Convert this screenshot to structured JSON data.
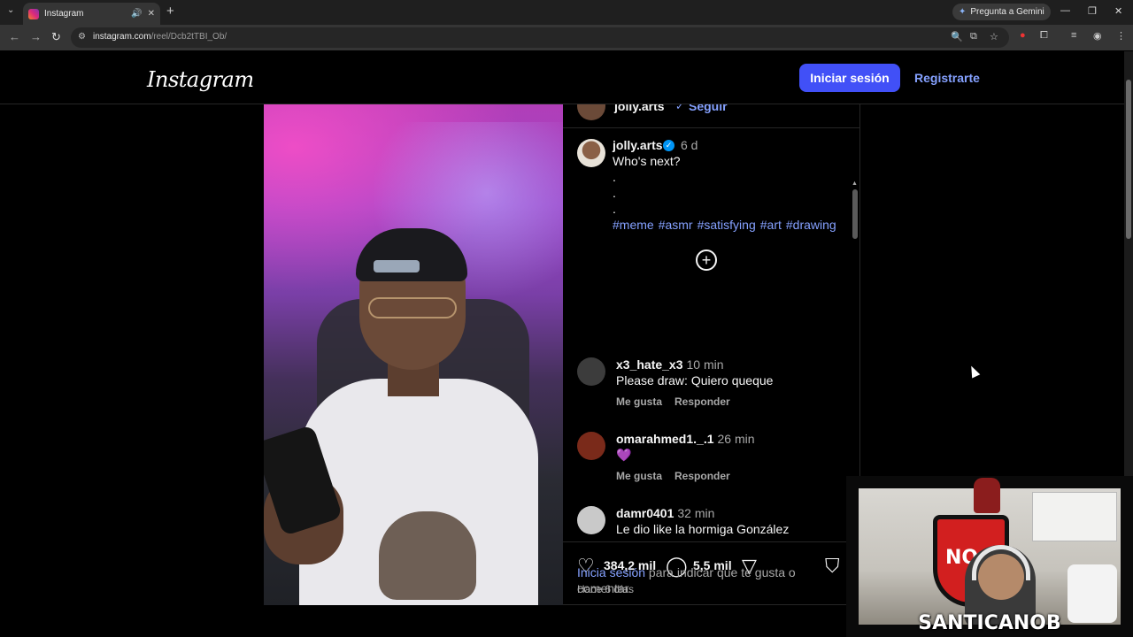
{
  "browser": {
    "tab_title": "Instagram",
    "url_host": "instagram.com",
    "url_path": "/reel/Dcb2tTBI_Ob/",
    "gemini_label": "Pregunta a Gemini"
  },
  "header": {
    "logo": "Instagram",
    "login_label": "Iniciar sesión",
    "signup_label": "Registrarte"
  },
  "post": {
    "author": "jolly.arts",
    "follow_label": "Seguir",
    "caption_time": "6 d",
    "caption_text": "Who's next?",
    "caption_dots": [
      ".",
      ".",
      "."
    ],
    "hashtags": [
      "#meme",
      "#asmr",
      "#satisfying",
      "#art",
      "#drawing"
    ]
  },
  "comments": [
    {
      "user": "x3_hate_x3",
      "time": "10 min",
      "text": "Please draw: Quiero queque",
      "like": "Me gusta",
      "reply": "Responder",
      "avatar_color": "#3c3c3c"
    },
    {
      "user": "omarahmed1._.1",
      "time": "26 min",
      "text": "💜",
      "like": "Me gusta",
      "reply": "Responder",
      "avatar_color": "#7a2a1a"
    },
    {
      "user": "damr0401",
      "time": "32 min",
      "text": "Le dio like la hormiga González",
      "like": "Me gusta",
      "reply": "Responder",
      "avatar_color": "#c9c9c9"
    }
  ],
  "actions": {
    "likes": "384,2 mil",
    "comments": "5,5 mil",
    "posted": "Hace 6 días"
  },
  "login_prompt": {
    "link": "Inicia sesión",
    "rest": " para indicar que te gusta o comentar."
  },
  "webcam": {
    "shield_text": "NO",
    "streamer_name": "SANTICANOB"
  }
}
